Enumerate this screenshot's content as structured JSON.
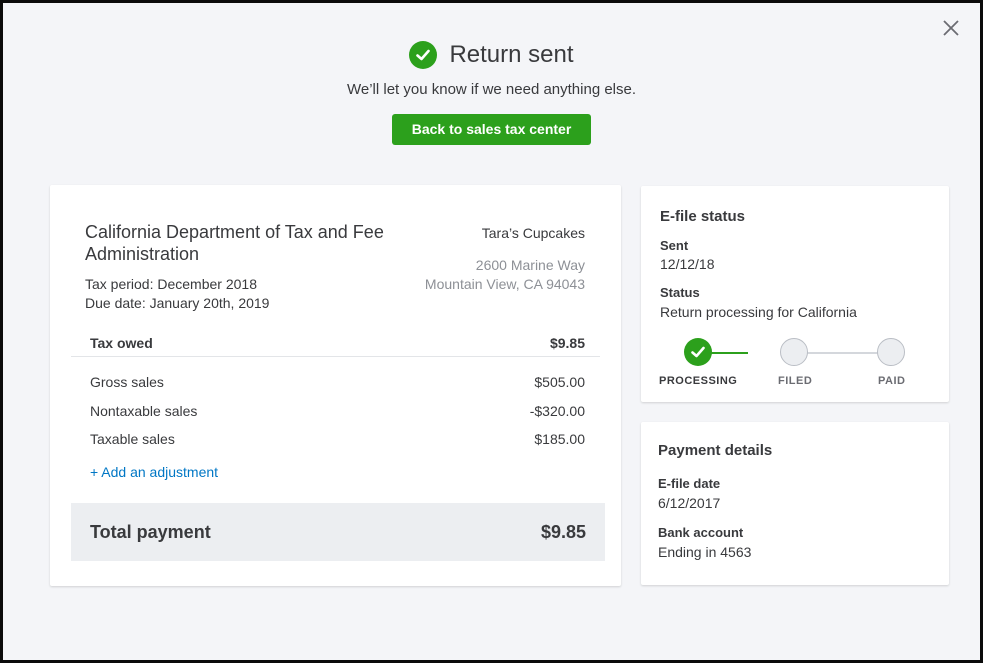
{
  "header": {
    "title": "Return sent",
    "subtitle": "We’ll let you know if we need anything else.",
    "back_button": "Back to sales tax center"
  },
  "return": {
    "agency": "California Department of Tax and Fee Administration",
    "tax_period": "Tax period: December 2018",
    "due_date": "Due date: January 20th, 2019",
    "business_name": "Tara’s Cupcakes",
    "address_line1": "2600 Marine Way",
    "address_line2": "Mountain View, CA 94043",
    "tax_owed_label": "Tax owed",
    "tax_owed_value": "$9.85",
    "lines": [
      {
        "label": "Gross sales",
        "value": "$505.00"
      },
      {
        "label": "Nontaxable sales",
        "value": "-$320.00"
      },
      {
        "label": "Taxable sales",
        "value": "$185.00"
      }
    ],
    "add_adjustment": "+ Add an adjustment",
    "total_label": "Total payment",
    "total_value": "$9.85"
  },
  "efile_status": {
    "title": "E-file status",
    "sent_label": "Sent",
    "sent_value": "12/12/18",
    "status_label": "Status",
    "status_value": "Return processing for California",
    "steps": [
      "PROCESSING",
      "FILED",
      "PAID"
    ]
  },
  "payment_details": {
    "title": "Payment details",
    "efile_date_label": "E-file date",
    "efile_date_value": "6/12/2017",
    "bank_label": "Bank account",
    "bank_value": "Ending in 4563"
  },
  "colors": {
    "accent": "#2ca01c",
    "link": "#0077c5",
    "text": "#393a3d",
    "muted": "#8d9096",
    "background": "#f4f5f8"
  },
  "icons": {
    "close": "close-icon",
    "success": "checkmark-icon"
  }
}
